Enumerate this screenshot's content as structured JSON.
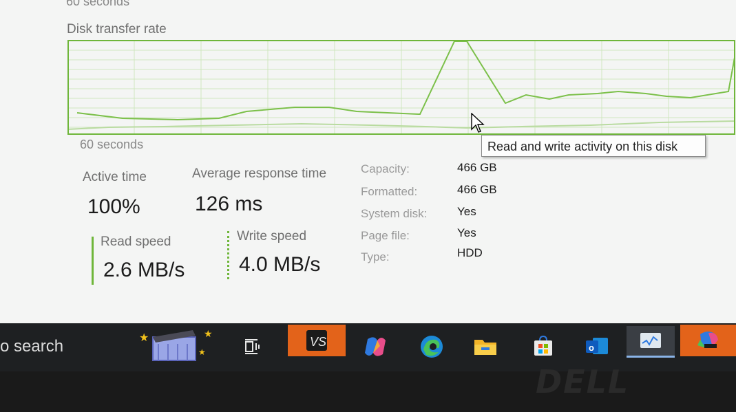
{
  "chart": {
    "top_caption": "60 seconds",
    "title": "Disk transfer rate",
    "bottom_caption": "60 seconds",
    "tooltip": "Read and write activity on this disk"
  },
  "stats": {
    "active_time_label": "Active time",
    "active_time_value": "100%",
    "avg_response_label": "Average response time",
    "avg_response_value": "126 ms",
    "read_speed_label": "Read speed",
    "read_speed_value": "2.6 MB/s",
    "write_speed_label": "Write speed",
    "write_speed_value": "4.0 MB/s"
  },
  "properties": [
    {
      "label": "Capacity:",
      "value": "466 GB"
    },
    {
      "label": "Formatted:",
      "value": "466 GB"
    },
    {
      "label": "System disk:",
      "value": "Yes"
    },
    {
      "label": "Page file:",
      "value": "Yes"
    },
    {
      "label": "Type:",
      "value": "HDD"
    }
  ],
  "taskbar": {
    "search_text": "o search",
    "apps": [
      "movie-maker-icon",
      "task-view-icon",
      "vscode-like-app-icon",
      "copilot-icon",
      "edge-icon",
      "file-explorer-icon",
      "microsoft-store-icon",
      "outlook-icon",
      "task-manager-icon",
      "microsoft-365-icon"
    ]
  },
  "bezel": {
    "brand": "DELL"
  },
  "colors": {
    "graph_line": "#7cc04a",
    "graph_border": "#6fb63a",
    "accent_orange": "#e3631a"
  }
}
